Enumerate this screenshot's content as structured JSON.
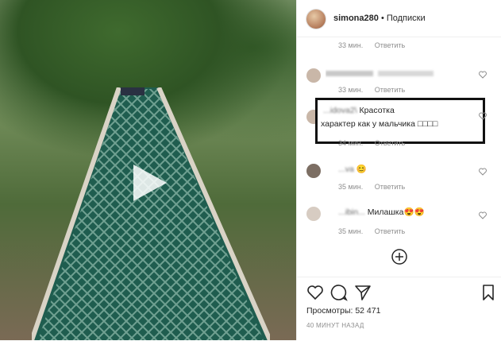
{
  "header": {
    "username": "simona280",
    "follow_label": "• Подписки"
  },
  "comments": [
    {
      "time": "33 мин.",
      "reply": "Ответить"
    },
    {
      "time": "33 мин.",
      "reply": "Ответить"
    },
    {
      "user": "...idova2\\",
      "line1": "Красотка",
      "line2": "характер как у мальчика □□□□",
      "time": "34 мин.",
      "reply": "Ответить"
    },
    {
      "user": "...va",
      "emoji": "😊",
      "time": "35 мин.",
      "reply": "Ответить"
    },
    {
      "user": "...ibin...",
      "text": "Милашка😍😍",
      "time": "35 мин.",
      "reply": "Ответить"
    }
  ],
  "stats": {
    "views": "Просмотры: 52 471",
    "time_ago": "40 МИНУТ НАЗАД"
  },
  "icons": [
    "heart-icon",
    "comment-icon",
    "share-icon",
    "bookmark-icon",
    "add-comment-icon",
    "play-icon"
  ],
  "colors": {
    "text": "#262626",
    "muted": "#8e8e8e",
    "border": "#efefef"
  }
}
